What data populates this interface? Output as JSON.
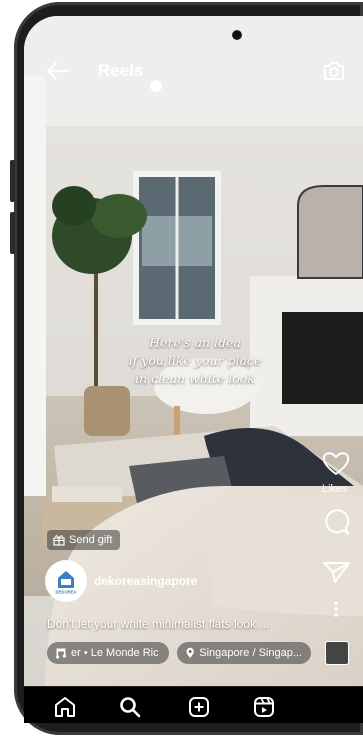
{
  "header": {
    "title": "Reels"
  },
  "video": {
    "overlay_lines": [
      "Here's an idea",
      "if you like your place",
      "in clean white look"
    ]
  },
  "actions": {
    "likes_label": "Likes"
  },
  "gift": {
    "label": "Send gift"
  },
  "post": {
    "username": "dekoreasingapore",
    "avatar_text": "DEKOREA",
    "caption": "Don't let your white minimalist flats look ..."
  },
  "audio": {
    "label": "er • Le Monde  Ric"
  },
  "location": {
    "label": "Singapore / Singap..."
  },
  "nav": {
    "items": [
      "home-icon",
      "search-icon",
      "create-icon",
      "reels-icon"
    ]
  }
}
